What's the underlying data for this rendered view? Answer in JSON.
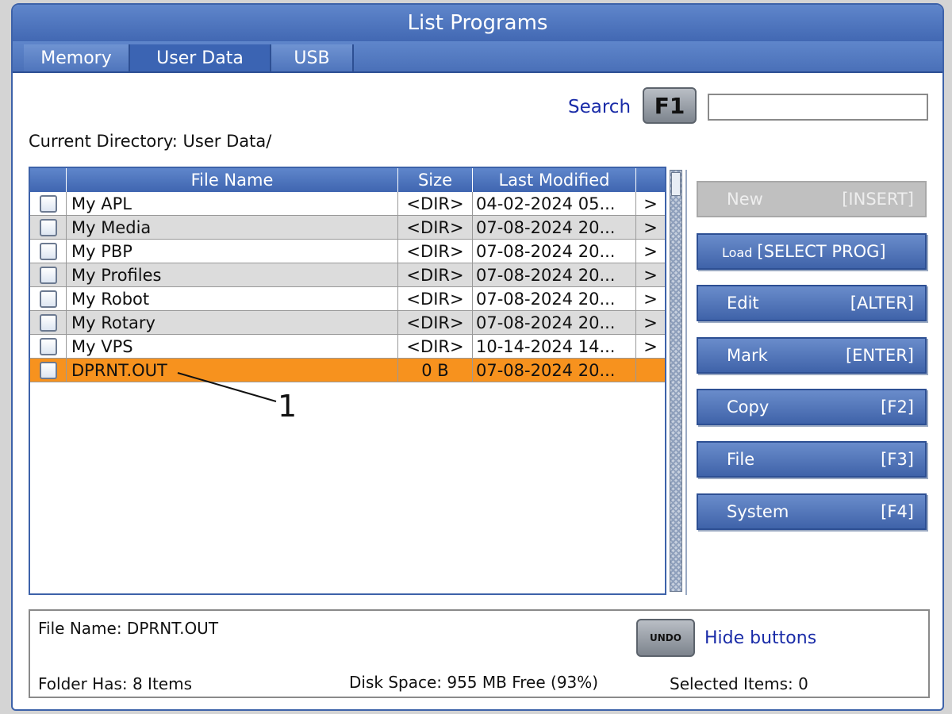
{
  "window": {
    "title": "List Programs"
  },
  "tabs": [
    {
      "label": "Memory",
      "active": false
    },
    {
      "label": "User Data",
      "active": true
    },
    {
      "label": "USB",
      "active": false
    }
  ],
  "search": {
    "label": "Search",
    "key": "F1",
    "value": ""
  },
  "current_directory": "Current Directory: User Data/",
  "table": {
    "columns": [
      "File Name",
      "Size",
      "Last Modified"
    ],
    "rows": [
      {
        "name": "My APL",
        "size": "<DIR>",
        "modified": "04-02-2024 05...",
        "arrow": ">"
      },
      {
        "name": "My Media",
        "size": "<DIR>",
        "modified": "07-08-2024 20...",
        "arrow": ">"
      },
      {
        "name": "My PBP",
        "size": "<DIR>",
        "modified": "07-08-2024 20...",
        "arrow": ">"
      },
      {
        "name": "My Profiles",
        "size": "<DIR>",
        "modified": "07-08-2024 20...",
        "arrow": ">"
      },
      {
        "name": "My Robot",
        "size": "<DIR>",
        "modified": "07-08-2024 20...",
        "arrow": ">"
      },
      {
        "name": "My Rotary",
        "size": "<DIR>",
        "modified": "07-08-2024 20...",
        "arrow": ">"
      },
      {
        "name": "My VPS",
        "size": "<DIR>",
        "modified": "10-14-2024 14...",
        "arrow": ">"
      },
      {
        "name": "DPRNT.OUT",
        "size": "0 B",
        "modified": "07-08-2024 20...",
        "arrow": ""
      }
    ],
    "selected_row_color": "#f7921e"
  },
  "buttons": [
    {
      "label": "New",
      "small": "",
      "key": "[INSERT]",
      "enabled": false
    },
    {
      "label": "",
      "small": "Load",
      "key": "[SELECT PROG]",
      "enabled": true
    },
    {
      "label": "Edit",
      "small": "",
      "key": "[ALTER]",
      "enabled": true
    },
    {
      "label": "Mark",
      "small": "",
      "key": "[ENTER]",
      "enabled": true
    },
    {
      "label": "Copy",
      "small": "",
      "key": "[F2]",
      "enabled": true
    },
    {
      "label": "File",
      "small": "",
      "key": "[F3]",
      "enabled": true
    },
    {
      "label": "System",
      "small": "",
      "key": "[F4]",
      "enabled": true
    }
  ],
  "info": {
    "file_name": "File Name: DPRNT.OUT",
    "folder_count": "Folder Has: 8 Items",
    "disk_space": "Disk Space: 955 MB Free (93%)",
    "selected_items": "Selected Items: 0",
    "undo_key": "UNDO",
    "hide_buttons": "Hide buttons"
  },
  "callout": {
    "label": "1"
  },
  "colors": {
    "accent": "#4268b3",
    "link": "#1a2ca8"
  }
}
